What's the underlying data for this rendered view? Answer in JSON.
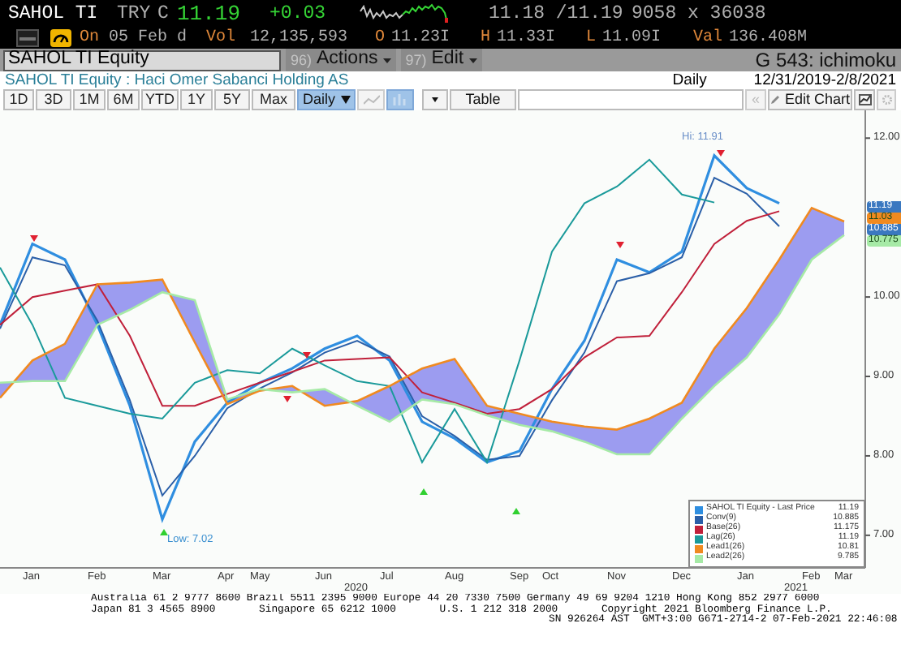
{
  "quote_bar": {
    "ticker": "SAHOL TI",
    "currency": "TRY",
    "price_label": "C",
    "price": "11.19",
    "change": "+0.03",
    "bid_ask": "11.18 /11.19",
    "size": "9058 x 36038"
  },
  "stats_bar": {
    "session": "On",
    "date": "05 Feb d",
    "fields": [
      {
        "label": "Vol",
        "value": "12,135,593"
      },
      {
        "label": "O",
        "value": "11.23I"
      },
      {
        "label": "H",
        "value": "11.33I"
      },
      {
        "label": "L",
        "value": "11.09I"
      },
      {
        "label": "Val",
        "value": "136.408M"
      }
    ]
  },
  "command_bar": {
    "security": "SAHOL TI Equity",
    "menus": [
      {
        "number": "96)",
        "label": "Actions"
      },
      {
        "number": "97)",
        "label": "Edit"
      }
    ],
    "function": "G 543: ichimoku"
  },
  "title_bar": {
    "title": "SAHOL TI Equity : Haci Omer Sabanci Holding AS",
    "period": "Daily",
    "range": "12/31/2019-2/8/2021"
  },
  "toolbar": {
    "ranges": [
      {
        "label": "1D",
        "selected": false
      },
      {
        "label": "3D",
        "selected": false
      },
      {
        "label": "1M",
        "selected": false
      },
      {
        "label": "6M",
        "selected": false
      },
      {
        "label": "YTD",
        "selected": false
      },
      {
        "label": "1Y",
        "selected": false
      },
      {
        "label": "5Y",
        "selected": false
      },
      {
        "label": "Max",
        "selected": false
      }
    ],
    "frequency": {
      "label": "Daily",
      "selected": true
    },
    "chart_type_buttons": [
      {
        "selected": false
      },
      {
        "selected": true
      }
    ],
    "table": "Table",
    "scroll_back": {
      "text": "«",
      "disabled": true
    },
    "edit_chart": "Edit Chart"
  },
  "chart": {
    "chart_data": {
      "type": "line",
      "categories": [
        null,
        "Jan",
        null,
        "Feb",
        null,
        "Mar",
        null,
        "Apr",
        "May",
        null,
        "Jun",
        null,
        "Jul",
        null,
        "Aug",
        null,
        "Sep",
        "Oct",
        null,
        "Nov",
        null,
        "Dec",
        null,
        "Jan",
        null,
        "Feb",
        "Mar"
      ],
      "ylim": [
        6.59,
        12.35
      ],
      "legend": "lower right",
      "yticks": [
        {
          "value": 12,
          "label": "12.00"
        },
        {
          "value": 10,
          "label": "10.00"
        },
        {
          "value": 9,
          "label": "9.00"
        },
        {
          "value": 8,
          "label": "8.00"
        },
        {
          "value": 7,
          "label": "7.00"
        }
      ],
      "series": [
        {
          "name": "SAHOL TI Equity - Last Price",
          "color": "#2f8ee0",
          "values": [
            9.65,
            10.67,
            10.47,
            9.65,
            8.63,
            7.2,
            8.18,
            8.67,
            8.92,
            9.1,
            9.35,
            9.51,
            9.2,
            8.43,
            8.22,
            7.92,
            8.06,
            8.84,
            9.45,
            10.47,
            10.31,
            10.57,
            11.78,
            11.37,
            11.18,
            null,
            null
          ]
        },
        {
          "name": "Conv(9)",
          "color": "#2a5fa8",
          "values": [
            9.6,
            10.5,
            10.4,
            9.7,
            8.7,
            7.5,
            8.0,
            8.6,
            8.85,
            9.05,
            9.3,
            9.45,
            9.25,
            8.5,
            8.25,
            7.95,
            8.0,
            8.7,
            9.3,
            10.2,
            10.3,
            10.5,
            11.5,
            11.3,
            10.89,
            null,
            null
          ]
        },
        {
          "name": "Base(26)",
          "color": "#c0203a",
          "values": [
            9.65,
            10.0,
            10.08,
            10.16,
            9.51,
            8.63,
            8.63,
            8.78,
            8.92,
            9.06,
            9.2,
            9.22,
            9.24,
            8.8,
            8.67,
            8.53,
            8.59,
            8.84,
            9.24,
            9.49,
            9.51,
            10.06,
            10.67,
            10.96,
            11.08,
            null,
            null
          ]
        },
        {
          "name": "Lag(26)",
          "color": "#1a9a9a",
          "values": [
            10.37,
            9.65,
            8.73,
            8.63,
            8.53,
            8.47,
            8.92,
            9.08,
            9.04,
            9.35,
            9.14,
            8.94,
            8.88,
            7.92,
            8.59,
            7.92,
            9.2,
            10.57,
            11.18,
            11.39,
            11.73,
            11.29,
            11.19,
            null,
            null,
            null,
            null
          ]
        },
        {
          "name": "Lead1(26)",
          "color": "#f08a20",
          "values": [
            8.73,
            9.2,
            9.41,
            10.16,
            10.18,
            10.22,
            9.43,
            8.65,
            8.82,
            8.88,
            8.63,
            8.69,
            8.88,
            9.1,
            9.22,
            8.63,
            8.53,
            8.43,
            8.37,
            8.33,
            8.47,
            8.67,
            9.35,
            9.86,
            10.47,
            11.12,
            10.95
          ]
        },
        {
          "name": "Lead2(26)",
          "color": "#a6eaa6",
          "values": [
            8.92,
            8.94,
            8.94,
            9.65,
            9.84,
            10.06,
            9.96,
            8.71,
            8.84,
            8.8,
            8.84,
            8.63,
            8.43,
            8.71,
            8.65,
            8.51,
            8.39,
            8.31,
            8.18,
            8.02,
            8.02,
            8.47,
            8.88,
            9.24,
            9.78,
            10.47,
            10.78
          ]
        }
      ],
      "annotations": [
        "Hi: 11.91",
        "Low: 7.02"
      ]
    },
    "years": [
      "2020",
      "2021"
    ],
    "legend_values": [
      "11.19",
      "10.885",
      "11.175",
      "11.19",
      "10.81",
      "9.785"
    ],
    "price_tags": [
      {
        "text": "11.19",
        "color": "#3a78c0"
      },
      {
        "text": "11.03",
        "color": "#f08a20"
      },
      {
        "text": "10.885",
        "color": "#3a78c0"
      },
      {
        "text": "10.775",
        "color": "#a6eaa6"
      }
    ]
  },
  "footer": [
    "Australia 61 2 9777 8600 Brazil 5511 2395 9000 Europe 44 20 7330 7500 Germany 49 69 9204 1210 Hong Kong 852 2977 6000",
    "Japan 81 3 4565 8900       Singapore 65 6212 1000       U.S. 1 212 318 2000       Copyright 2021 Bloomberg Finance L.P.",
    "SN 926264 AST  GMT+3:00 G671-2714-2 07-Feb-2021 22:46:08"
  ]
}
